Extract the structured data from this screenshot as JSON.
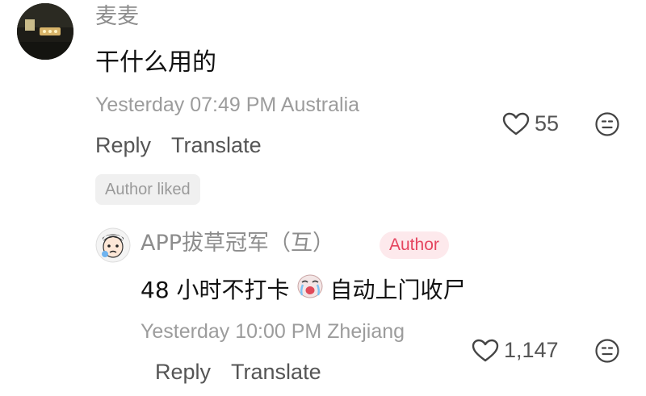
{
  "comment": {
    "username": "麦麦",
    "text": "干什么用的",
    "meta": "Yesterday 07:49 PM Australia",
    "reply_label": "Reply",
    "translate_label": "Translate",
    "likes": "55",
    "author_liked": "Author liked"
  },
  "reply": {
    "username": "APP拔草冠军（互）",
    "author_badge": "Author",
    "text_before": "48 小时不打卡",
    "text_after": "自动上门收尸",
    "meta": "Yesterday 10:00 PM Zhejiang",
    "reply_label": "Reply",
    "translate_label": "Translate",
    "likes": "1,147"
  },
  "icons": {
    "heart": "heart-outline-icon",
    "emoji": "emoji-reaction-icon",
    "crying_emoji": "crying-face-emoji"
  },
  "colors": {
    "author_badge_bg": "#fde9ec",
    "author_badge_text": "#e5455f",
    "secondary_text": "#9c9c9c"
  }
}
